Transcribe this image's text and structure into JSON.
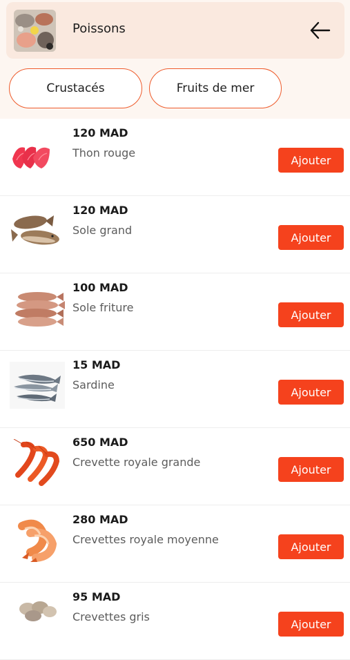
{
  "header": {
    "title": "Poissons",
    "back_icon": "arrow-left-icon",
    "thumbnail_icon": "seafood-platter-image"
  },
  "categories": [
    {
      "label": "Crustacés"
    },
    {
      "label": "Fruits de mer"
    }
  ],
  "colors": {
    "accent": "#f5421d",
    "chip_border": "#ee5a2a",
    "header_bg": "#fae9df",
    "top_bg": "#fdf6f1"
  },
  "products": [
    {
      "price": "120 MAD",
      "name": "Thon rouge",
      "button": "Ajouter",
      "image": "tuna-steak-image"
    },
    {
      "price": "120 MAD",
      "name": "Sole grand",
      "button": "Ajouter",
      "image": "sole-fish-image"
    },
    {
      "price": "100 MAD",
      "name": "Sole friture",
      "button": "Ajouter",
      "image": "small-sole-fish-image"
    },
    {
      "price": "15 MAD",
      "name": "Sardine",
      "button": "Ajouter",
      "image": "sardine-image"
    },
    {
      "price": "650 MAD",
      "name": "Crevette royale grande",
      "button": "Ajouter",
      "image": "king-prawn-image"
    },
    {
      "price": "280 MAD",
      "name": "Crevettes royale moyenne",
      "button": "Ajouter",
      "image": "shrimp-image"
    },
    {
      "price": "95 MAD",
      "name": "Crevettes gris",
      "button": "Ajouter",
      "image": "grey-shrimp-image"
    }
  ]
}
